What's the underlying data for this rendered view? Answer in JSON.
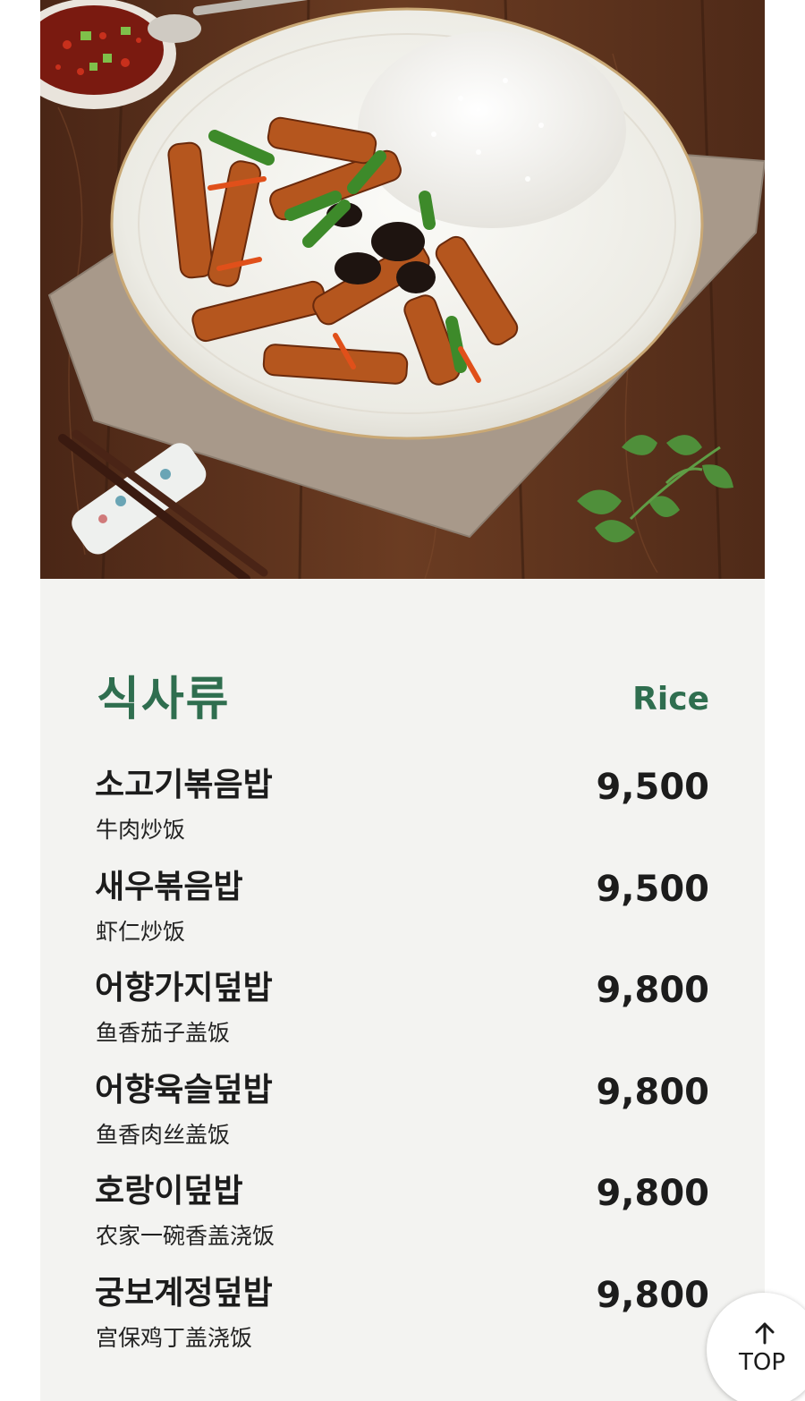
{
  "hero_image": {
    "description": "food-photo"
  },
  "section": {
    "title_ko": "식사류",
    "title_en": "Rice"
  },
  "menu": {
    "items": [
      {
        "name_ko": "소고기볶음밥",
        "name_zh": "牛肉炒饭",
        "price": "9,500"
      },
      {
        "name_ko": "새우볶음밥",
        "name_zh": "虾仁炒饭",
        "price": "9,500"
      },
      {
        "name_ko": "어향가지덮밥",
        "name_zh": "鱼香茄子盖饭",
        "price": "9,800"
      },
      {
        "name_ko": "어향육슬덮밥",
        "name_zh": "鱼香肉丝盖饭",
        "price": "9,800"
      },
      {
        "name_ko": "호랑이덮밥",
        "name_zh": "农家一碗香盖浇饭",
        "price": "9,800"
      },
      {
        "name_ko": "궁보계정덮밥",
        "name_zh": "宫保鸡丁盖浇饭",
        "price": "9,800"
      }
    ]
  },
  "top_button": {
    "label": "TOP",
    "icon": "arrow-up-icon"
  },
  "colors": {
    "accent_green": "#2f6e4f",
    "panel_bg": "#f3f3f1",
    "text_dark": "#1c1c1c"
  }
}
